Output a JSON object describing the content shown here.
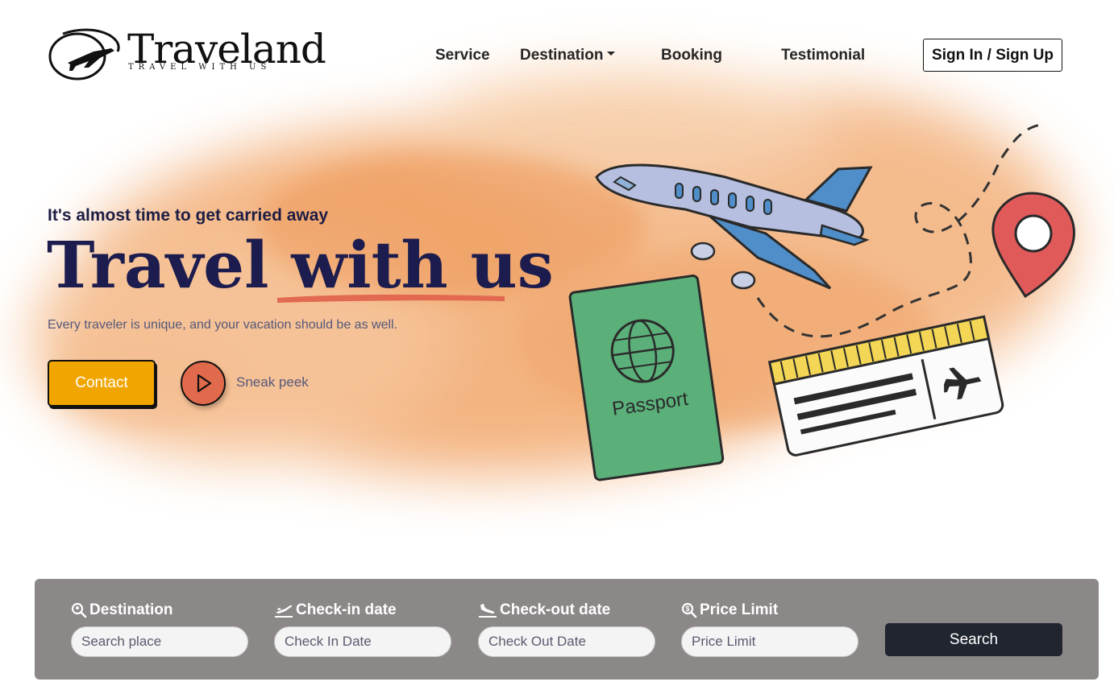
{
  "brand": {
    "name": "Traveland",
    "tagline": "TRAVEL WITH US"
  },
  "nav": {
    "items": [
      {
        "label": "Service"
      },
      {
        "label": "Destination"
      },
      {
        "label": "Booking"
      },
      {
        "label": "Testimonial"
      }
    ],
    "signin_label": "Sign In / Sign Up"
  },
  "hero": {
    "kicker": "It's almost time to get carried away",
    "title": "Travel with us",
    "subtitle": "Every traveler is unique, and your vacation should be as well.",
    "contact_label": "Contact",
    "sneak_label": "Sneak peek",
    "illustration": {
      "passport_text": "Passport"
    }
  },
  "search": {
    "fields": [
      {
        "label": "Destination",
        "placeholder": "Search place",
        "icon": "search-location-icon"
      },
      {
        "label": "Check-in date",
        "placeholder": "Check In Date",
        "icon": "plane-departure-icon"
      },
      {
        "label": "Check-out date",
        "placeholder": "Check Out Date",
        "icon": "plane-arrival-icon"
      },
      {
        "label": "Price Limit",
        "placeholder": "Price Limit",
        "icon": "search-dollar-icon"
      }
    ],
    "button_label": "Search"
  },
  "colors": {
    "splash": "#f0a46a",
    "title": "#1c1c4e",
    "contact_bg": "#f0a500",
    "play_bg": "#e26a4c",
    "panel_bg": "#8c8888",
    "search_bg": "#212530"
  }
}
